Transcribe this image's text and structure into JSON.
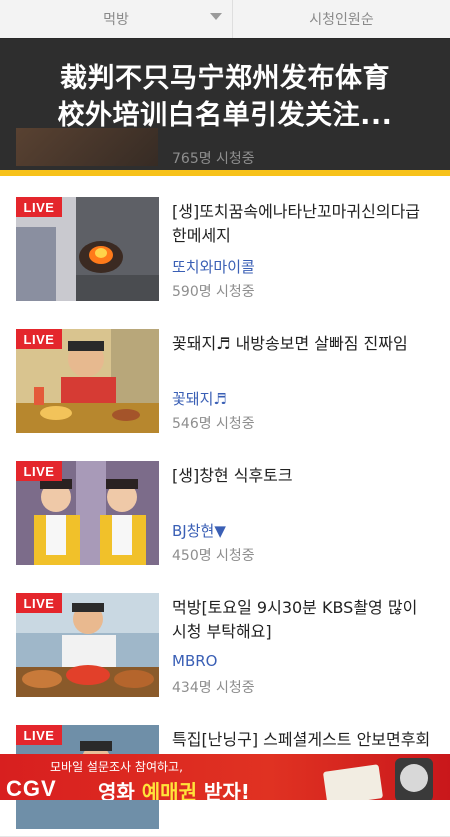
{
  "filters": {
    "category": "먹방",
    "sort": "시청인원순"
  },
  "headline": {
    "line1": "裁判不只马宁郑州发布体育",
    "line2": "校外培训白名单引发关注..."
  },
  "behind_overlay": {
    "viewers": "765명 시청중"
  },
  "live_badge": "LIVE",
  "items": [
    {
      "title": "[생]또치꿈속에나타난꼬마귀신의다급\n한메세지",
      "channel": "또치와마이콜",
      "viewers": "590명 시청중"
    },
    {
      "title": "꽃돼지♬ 내방송보면 살빠짐 진짜임",
      "channel": "꽃돼지♬",
      "viewers": "546명 시청중"
    },
    {
      "title": "[생]창현 식후토크",
      "channel": "BJ창현▼",
      "viewers": "450명 시청중"
    },
    {
      "title": "먹방[토요일 9시30분 KBS촬영 많이\n시청 부탁해요]",
      "channel": "MBRO",
      "viewers": "434명 시청중"
    },
    {
      "title": "특집[난닝구] 스페셜게스트 안보면후회",
      "channel": "",
      "viewers": ""
    }
  ],
  "ad": {
    "line1": "모바일 설문조사 참여하고,",
    "brand": "CGV",
    "line2_prefix": "영화 ",
    "line2_highlight": "예매권",
    "line2_suffix": " 받자!"
  },
  "colors": {
    "live_red": "#e4262c",
    "channel_blue": "#3a5fb5",
    "accent_yellow": "#f7c21a",
    "ad_red": "#d81f1f"
  }
}
